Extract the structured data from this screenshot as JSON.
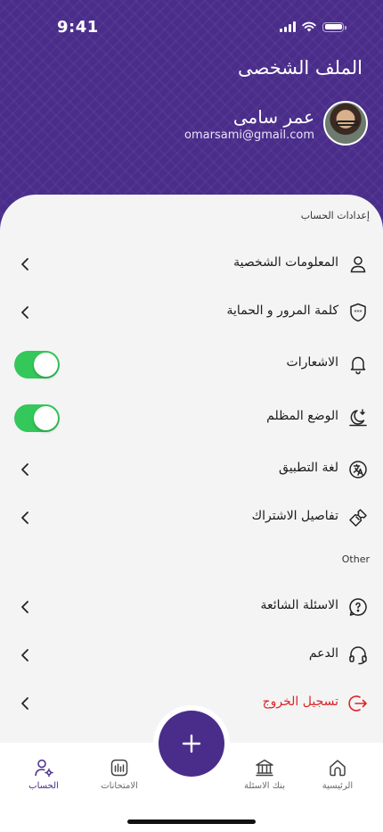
{
  "status_bar": {
    "time": "9:41"
  },
  "header": {
    "title": "الملف الشخصى",
    "user_name": "عمر سامى",
    "user_email": "omarsami@gmail.com"
  },
  "sections": {
    "account_settings": "إعدادات الحساب",
    "other": "Other"
  },
  "menu": {
    "personal_info": "المعلومات الشخصية",
    "password_security": "كلمة المرور و الحماية",
    "notifications": "الاشعارات",
    "dark_mode": "الوضع المظلم",
    "app_language": "لغة التطبيق",
    "subscription_details": "تفاصيل الاشتراك",
    "faq": "الاسئلة الشائعة",
    "support": "الدعم",
    "logout": "تسجيل الخروج"
  },
  "toggles": {
    "notifications_on": true,
    "dark_mode_on": true
  },
  "bottom_nav": {
    "home": "الرئيسية",
    "question_bank": "بنك الاسئلة",
    "exams": "الامتحانات",
    "account": "الحساب"
  },
  "colors": {
    "primary": "#4a2d8a",
    "toggle_on": "#34c759",
    "danger": "#e02424"
  }
}
